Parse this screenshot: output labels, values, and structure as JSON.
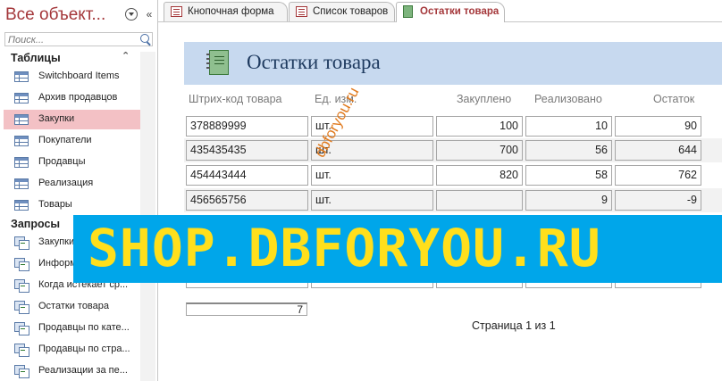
{
  "nav": {
    "title": "Все объект...",
    "search_placeholder": "Поиск...",
    "groups": [
      {
        "label": "Таблицы",
        "chevron": "⌃"
      },
      {
        "label": "Запросы"
      }
    ],
    "tables": [
      "Switchboard Items",
      "Архив продавцов",
      "Закупки",
      "Покупатели",
      "Продавцы",
      "Реализация",
      "Товары"
    ],
    "queries": [
      "Закупки",
      "Информ...",
      "Когда истекает ср...",
      "Остатки товара",
      "Продавцы по кате...",
      "Продавцы по стра...",
      "Реализации за пе..."
    ]
  },
  "tabs": [
    {
      "label": "Кнопочная форма"
    },
    {
      "label": "Список товаров"
    },
    {
      "label": "Остатки товара"
    }
  ],
  "report": {
    "title": "Остатки товара",
    "columns": [
      "Штрих-код товара",
      "Ед. изм.",
      "Закуплено",
      "Реализовано",
      "Остаток"
    ],
    "rows": [
      [
        "378889999",
        "шт.",
        "100",
        "10",
        "90"
      ],
      [
        "435435435",
        "шт.",
        "700",
        "56",
        "644"
      ],
      [
        "454443444",
        "шт.",
        "820",
        "58",
        "762"
      ],
      [
        "456565756",
        "шт.",
        "",
        "9",
        "-9"
      ]
    ],
    "total": "7",
    "page": "Страница 1 из 1"
  },
  "overlay": {
    "banner": "SHOP.DBFORYOU.RU",
    "watermark": "dbforyou.ru"
  },
  "colors": {
    "accent": "#a4373a",
    "header_band": "#c7d9ef",
    "banner_bg": "#00a6ea",
    "banner_text": "#ffdf1c",
    "selection": "#f3c1c5"
  }
}
